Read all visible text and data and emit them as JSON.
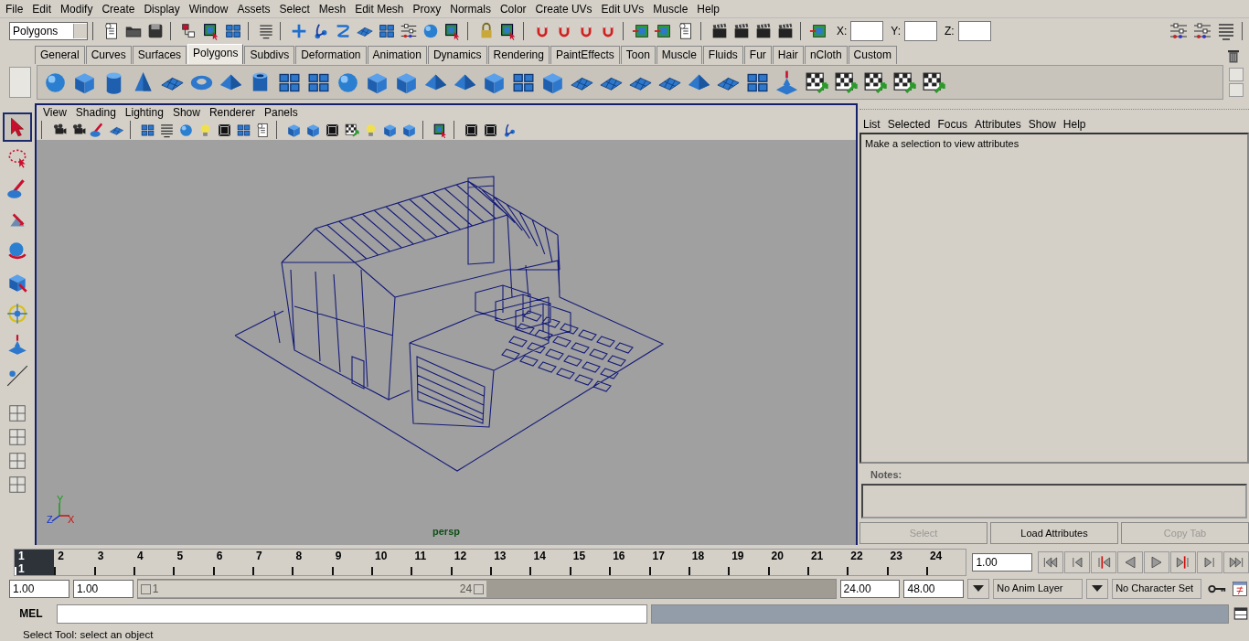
{
  "menubar": [
    "File",
    "Edit",
    "Modify",
    "Create",
    "Display",
    "Window",
    "Assets",
    "Select",
    "Mesh",
    "Edit Mesh",
    "Proxy",
    "Normals",
    "Color",
    "Create UVs",
    "Edit UVs",
    "Muscle",
    "Help"
  ],
  "status_line": {
    "mode": "Polygons",
    "fields": [
      {
        "label": "X:"
      },
      {
        "label": "Y:"
      },
      {
        "label": "Z:"
      }
    ]
  },
  "shelf": {
    "tabs": [
      {
        "label": "General",
        "selected": false
      },
      {
        "label": "Curves",
        "selected": false
      },
      {
        "label": "Surfaces",
        "selected": false
      },
      {
        "label": "Polygons",
        "selected": true
      },
      {
        "label": "Subdivs",
        "selected": false
      },
      {
        "label": "Deformation",
        "selected": false
      },
      {
        "label": "Animation",
        "selected": false
      },
      {
        "label": "Dynamics",
        "selected": false
      },
      {
        "label": "Rendering",
        "selected": false
      },
      {
        "label": "PaintEffects",
        "selected": false
      },
      {
        "label": "Toon",
        "selected": false
      },
      {
        "label": "Muscle",
        "selected": false
      },
      {
        "label": "Fluids",
        "selected": false
      },
      {
        "label": "Fur",
        "selected": false
      },
      {
        "label": "Hair",
        "selected": false
      },
      {
        "label": "nCloth",
        "selected": false
      },
      {
        "label": "Custom",
        "selected": false
      }
    ]
  },
  "toolbox": {
    "tools": [
      {
        "kind": "select",
        "selected": true
      },
      {
        "kind": "lasso",
        "selected": false
      },
      {
        "kind": "paint",
        "selected": false
      },
      {
        "kind": "move",
        "selected": false
      },
      {
        "kind": "rotate",
        "selected": false
      },
      {
        "kind": "scale",
        "selected": false
      },
      {
        "kind": "manip",
        "selected": false
      },
      {
        "kind": "soft",
        "selected": false
      },
      {
        "kind": "last",
        "selected": false
      }
    ]
  },
  "viewport": {
    "menu": [
      "View",
      "Shading",
      "Lighting",
      "Show",
      "Renderer",
      "Panels"
    ],
    "camera": "persp",
    "axes": {
      "y": "Y",
      "z": "Z",
      "x": "X"
    }
  },
  "attribute_editor": {
    "menu": [
      "List",
      "Selected",
      "Focus",
      "Attributes",
      "Show",
      "Help"
    ],
    "message": "Make a selection to view attributes",
    "notes_label": "Notes:",
    "buttons": [
      {
        "label": "Select",
        "disabled": true
      },
      {
        "label": "Load Attributes",
        "disabled": false
      },
      {
        "label": "Copy Tab",
        "disabled": true
      }
    ]
  },
  "time_slider": {
    "frames": [
      {
        "label": "1",
        "selected": true
      },
      {
        "label": "2",
        "selected": false
      },
      {
        "label": "3",
        "selected": false
      },
      {
        "label": "4",
        "selected": false
      },
      {
        "label": "5",
        "selected": false
      },
      {
        "label": "6",
        "selected": false
      },
      {
        "label": "7",
        "selected": false
      },
      {
        "label": "8",
        "selected": false
      },
      {
        "label": "9",
        "selected": false
      },
      {
        "label": "10",
        "selected": false
      },
      {
        "label": "11",
        "selected": false
      },
      {
        "label": "12",
        "selected": false
      },
      {
        "label": "13",
        "selected": false
      },
      {
        "label": "14",
        "selected": false
      },
      {
        "label": "15",
        "selected": false
      },
      {
        "label": "16",
        "selected": false
      },
      {
        "label": "17",
        "selected": false
      },
      {
        "label": "18",
        "selected": false
      },
      {
        "label": "19",
        "selected": false
      },
      {
        "label": "20",
        "selected": false
      },
      {
        "label": "21",
        "selected": false
      },
      {
        "label": "22",
        "selected": false
      },
      {
        "label": "23",
        "selected": false
      },
      {
        "label": "24",
        "selected": false
      }
    ],
    "current_frame": "1",
    "current_time": "1.00"
  },
  "range_slider": {
    "start_time": "1.00",
    "playback_start": "1.00",
    "handle_start": "1",
    "handle_end": "24",
    "playback_end": "24.00",
    "end_time": "48.00",
    "anim_layer": "No Anim Layer",
    "character_set": "No Character Set"
  },
  "command_line": {
    "label": "MEL"
  },
  "help_line": "Select Tool: select an object"
}
